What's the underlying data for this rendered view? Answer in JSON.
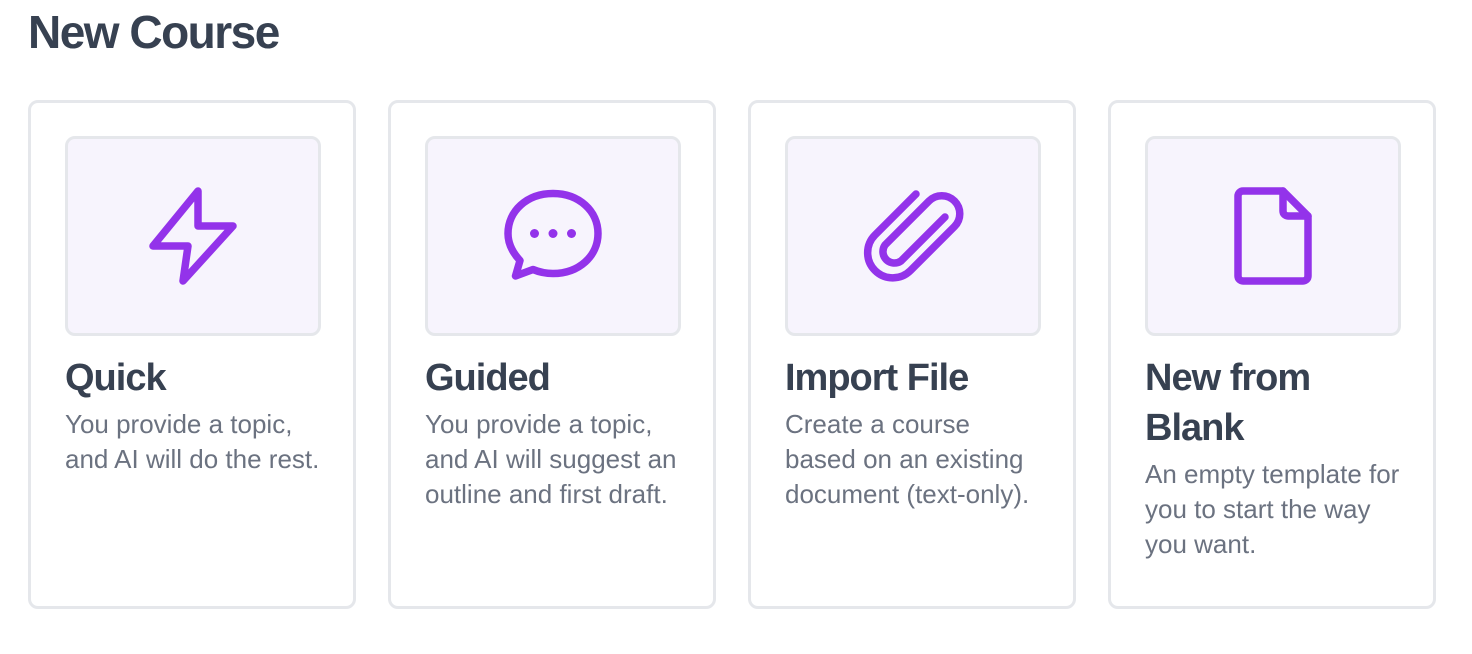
{
  "page": {
    "title": "New Course"
  },
  "colors": {
    "accent": "#9333ea",
    "icon_background": "#f7f4fd",
    "border": "#e5e7eb",
    "title_text": "#374151",
    "body_text": "#6b7280"
  },
  "options": [
    {
      "icon": "lightning-bolt-icon",
      "title": "Quick",
      "description": "You provide a topic, and AI will do the rest."
    },
    {
      "icon": "chat-bubble-icon",
      "title": "Guided",
      "description": "You provide a topic, and AI will suggest an outline and first draft."
    },
    {
      "icon": "paperclip-icon",
      "title": "Import File",
      "description": "Create a course based on an existing document (text-only)."
    },
    {
      "icon": "document-icon",
      "title": "New from Blank",
      "description": "An empty template for you to start the way you want."
    }
  ]
}
